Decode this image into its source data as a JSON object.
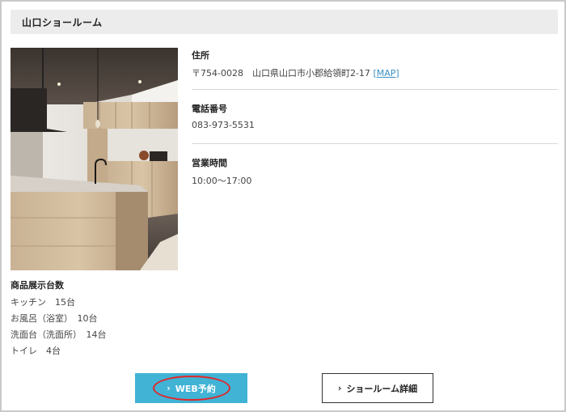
{
  "showroom": {
    "name": "山口ショールーム"
  },
  "address": {
    "label": "住所",
    "value": "〒754-0028　山口県山口市小郡給領町2-17",
    "map_open": "[",
    "map_link": "MAP",
    "map_close": "]"
  },
  "phone": {
    "label": "電話番号",
    "value": "083-973-5531"
  },
  "hours": {
    "label": "営業時間",
    "value": "10:00〜17:00"
  },
  "stock": {
    "title": "商品展示台数",
    "items": [
      "キッチン　15台",
      "お風呂（浴室）　10台",
      "洗面台（洗面所）　14台",
      "トイレ　4台"
    ]
  },
  "buttons": {
    "web_reserve": "WEB予約",
    "details": "ショールーム詳細",
    "chevron": "›"
  },
  "colors": {
    "accent": "#41b3d5",
    "highlight_circle": "#e0272b",
    "link": "#3c8fc4"
  }
}
